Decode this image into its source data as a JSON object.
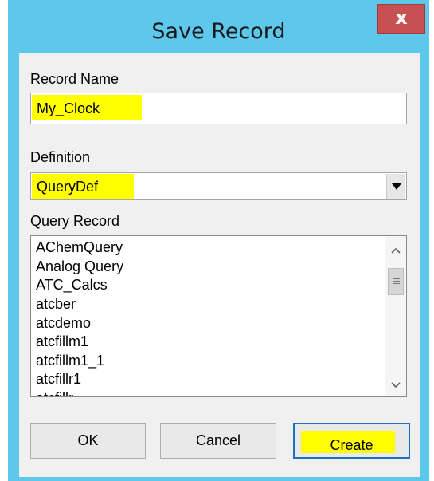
{
  "dialog": {
    "title": "Save Record",
    "close_glyph": "x"
  },
  "record_name": {
    "label": "Record Name",
    "value": "My_Clock"
  },
  "definition": {
    "label": "Definition",
    "selected": "QueryDef"
  },
  "query_record": {
    "label": "Query Record",
    "items": [
      "AChemQuery",
      "Analog Query",
      "ATC_Calcs",
      "atcber",
      "atcdemo",
      "atcfillm1",
      "atcfillm1_1",
      "atcfillr1",
      "atcfillr..."
    ]
  },
  "buttons": {
    "ok": "OK",
    "cancel": "Cancel",
    "create": "Create"
  },
  "colors": {
    "highlight": "#ffff00",
    "titlebar": "#5dc7ec",
    "close": "#c75050"
  }
}
